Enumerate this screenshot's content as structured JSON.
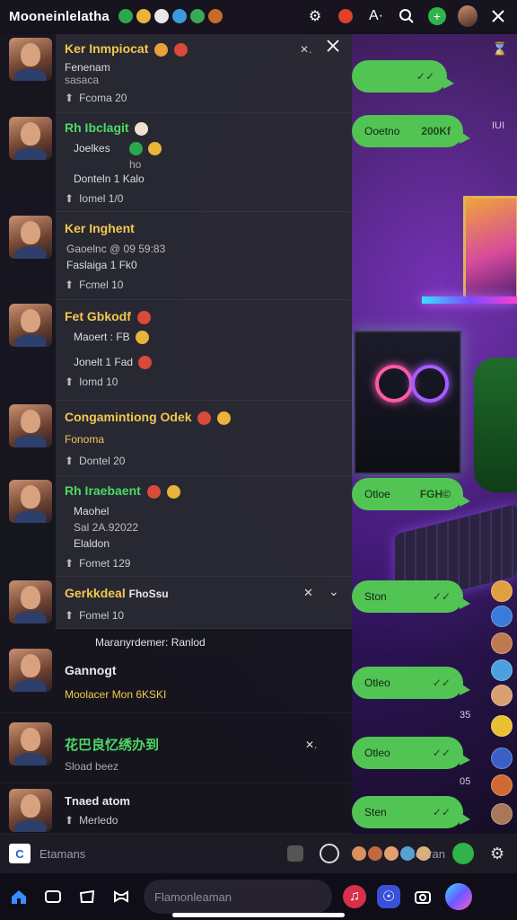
{
  "status_bar": {
    "app_title": "Mooneinlelatha",
    "emoji_colors": [
      "#2aa84a",
      "#e9b43a",
      "#e8e8e8",
      "#3a9be0",
      "#3aa856",
      "#c86a2a"
    ],
    "right_icons": [
      "gear-icon",
      "badge-icon",
      "ai-icon",
      "search-icon",
      "add-icon",
      "profile-avatar",
      "close-icon"
    ],
    "ai_label": "A·"
  },
  "chats": [
    {
      "name": "Ker Inmpiocat",
      "name_color": "#f2c94c",
      "line1": "Fenenam",
      "line2": "sasaca",
      "meta": "Fcoma 20"
    },
    {
      "name": "Rh Ibclagit",
      "name_color": "#4cd964",
      "line1": "Joelkes",
      "line2": "ho",
      "line3": "Donteln 1 Kalo",
      "meta": "Iomel 1/0"
    },
    {
      "name": "Ker Inghent",
      "name_color": "#f2c94c",
      "line1": "Gaoelnc @ 09 59:83",
      "line2": "Faslaiga 1 Fk0",
      "meta": "Fcmel 10"
    },
    {
      "name": "Fet Gbkodf",
      "name_color": "#f2c94c",
      "line1": "Maoert : FB",
      "line2": "Jonelt 1 Fad",
      "meta": "Iomd 10"
    },
    {
      "name": "Congamintiong Odek",
      "name_color": "#f2c94c",
      "line1": "Fonoma",
      "meta": "Dontel 20"
    },
    {
      "name": "Rh Iraebaent",
      "name_color": "#4cd964",
      "line1": "Maohel",
      "line2": "Sal   2A.92022",
      "line3": "Elaldon",
      "meta": "Fomet 129"
    },
    {
      "name": "Gerkkdeal",
      "name_extra": "FhoSsu",
      "name_color": "#f2c94c",
      "meta": "Fomel 10"
    },
    {
      "header": "Maranyrdemer: Ranlod",
      "name": "Gannogt",
      "name_color": "#e8e8ee",
      "line1": "Moolacer Mon 6KSKI"
    },
    {
      "name": "花巴良忆绣办到",
      "name_color": "#4cd964",
      "line1": "Sload beez"
    },
    {
      "name": "Tnaed atom",
      "name_color": "#e8e8ee",
      "line1": "Merledo"
    }
  ],
  "bubbles": [
    {
      "text": "",
      "ticks": "✓✓",
      "icon": ""
    },
    {
      "text": "Ooetno",
      "ticks": "200Kf",
      "icon": ""
    },
    {
      "text": "Otloe",
      "ticks": "FGH©",
      "icon": ""
    },
    {
      "text": "Ston",
      "ticks": "✓✓",
      "icon": ""
    },
    {
      "text": "Otleo",
      "ticks": "✓✓",
      "icon": ""
    },
    {
      "text": "Otleo",
      "ticks": "✓✓",
      "icon": ""
    },
    {
      "text": "Sten",
      "ticks": "✓✓",
      "icon": ""
    }
  ],
  "timestamps": [
    "IUI",
    "35",
    "05"
  ],
  "compose": {
    "badge": "C",
    "placeholder": "Etamans",
    "right_text": "Moaran"
  },
  "bottom_nav": {
    "search_placeholder": "Flamonleaman"
  }
}
